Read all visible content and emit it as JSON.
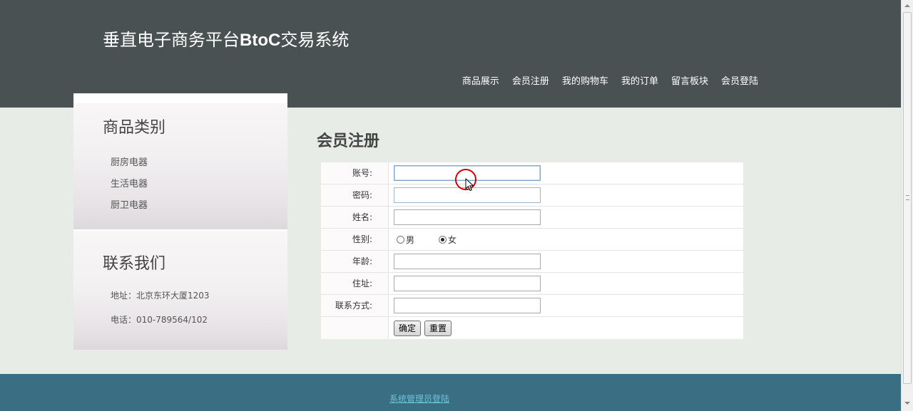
{
  "header": {
    "title_cn1": "垂直电子商务平台",
    "title_latin": "BtoC",
    "title_cn2": "交易系统",
    "nav": [
      {
        "label": "商品展示"
      },
      {
        "label": "会员注册"
      },
      {
        "label": "我的购物车"
      },
      {
        "label": "我的订单"
      },
      {
        "label": "留言板块"
      },
      {
        "label": "会员登陆"
      }
    ]
  },
  "sidebar": {
    "categories_title": "商品类别",
    "categories": [
      "厨房电器",
      "生活电器",
      "厨卫电器"
    ],
    "contact_title": "联系我们",
    "contact_items": [
      "地址：北京东环大厦1203",
      "电话：010-789564/102"
    ]
  },
  "main": {
    "title": "会员注册",
    "form": {
      "account_label": "账号:",
      "password_label": "密码:",
      "name_label": "姓名:",
      "gender_label": "性别:",
      "gender_male": "男",
      "gender_female": "女",
      "gender_selected": "女",
      "age_label": "年龄:",
      "address_label": "住址:",
      "contact_label": "联系方式:",
      "account_value": "",
      "password_value": "",
      "name_value": "",
      "age_value": "",
      "address_value": "",
      "contact_value": "",
      "submit_label": "确定",
      "reset_label": "重置"
    }
  },
  "footer": {
    "admin_login": "系统管理员登陆"
  },
  "icons": {
    "cursor": "mouse-pointer-icon",
    "click": "click-indicator-icon"
  }
}
